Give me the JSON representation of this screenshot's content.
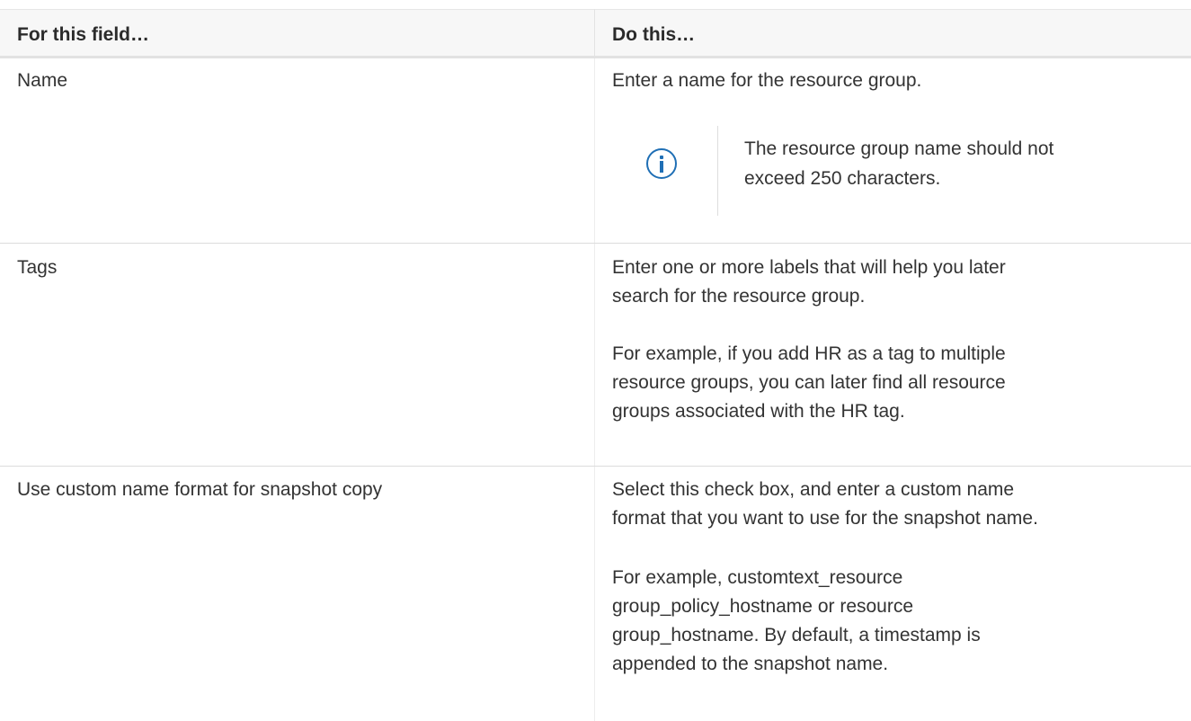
{
  "table": {
    "headers": {
      "field": "For this field…",
      "action": "Do this…"
    },
    "rows": [
      {
        "field": "Name",
        "action": [
          "Enter a name for the resource group."
        ],
        "note": {
          "icon": "info-icon",
          "text": [
            "The resource group name should not",
            "exceed 250 characters."
          ]
        }
      },
      {
        "field": "Tags",
        "action": [
          "Enter one or more labels that will help you later",
          "search for the resource group."
        ],
        "example": [
          "For example, if you add HR as a tag to multiple",
          "resource groups, you can later find all resource",
          "groups associated with the HR tag."
        ]
      },
      {
        "field": "Use custom name format for snapshot copy",
        "action": [
          "Select this check box, and enter a custom name",
          "format that you want to use for the snapshot name."
        ],
        "example": [
          "For example, customtext_resource",
          "group_policy_hostname or resource",
          "group_hostname. By default, a timestamp is",
          "appended to the snapshot name."
        ]
      }
    ]
  },
  "colors": {
    "info_icon": "#1f6fb5",
    "header_bg": "#f7f7f7",
    "text": "#333333"
  }
}
